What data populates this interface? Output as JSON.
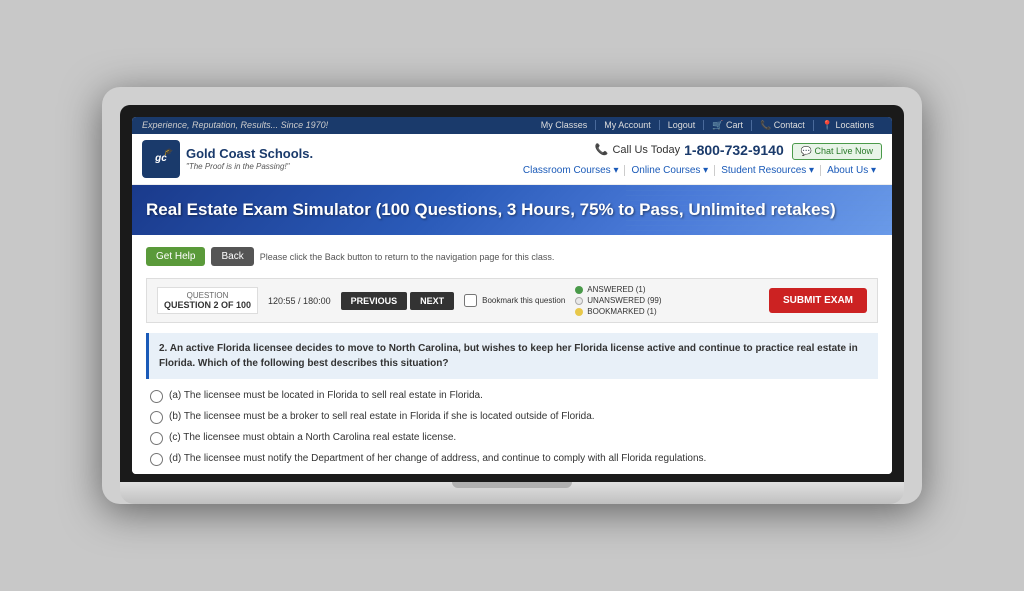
{
  "topbar": {
    "tagline": "Experience, Reputation, Results... Since 1970!",
    "links": [
      "My Classes",
      "My Account",
      "Logout",
      "🛒 Cart",
      "📞 Contact",
      "📍 Locations"
    ]
  },
  "logo": {
    "initials": "gc",
    "name": "Gold Coast Schools.",
    "tagline": "\"The Proof is in the Passing!\""
  },
  "phone": {
    "label": "Call Us Today",
    "number": "1-800-732-9140",
    "chat": "💬 Chat Live Now"
  },
  "subnav": {
    "links": [
      "Classroom Courses ▾",
      "Online Courses ▾",
      "Student Resources ▾",
      "About Us ▾"
    ]
  },
  "hero": {
    "title": "Real Estate Exam Simulator (100 Questions, 3 Hours, 75% to Pass, Unlimited retakes)"
  },
  "actions": {
    "get_help": "Get Help",
    "back": "Back",
    "help_text": "Please click the Back button to return to the navigation page for this class."
  },
  "quiz": {
    "question_label": "QUESTION 2 OF 100",
    "timer": "120:55 / 180:00",
    "prev_label": "PREVIOUS",
    "next_label": "NEXT",
    "bookmark_label": "Bookmark this question",
    "stats": [
      {
        "label": "ANSWERED (1)",
        "type": "answered"
      },
      {
        "label": "UNANSWERED (99)",
        "type": "unanswered"
      },
      {
        "label": "BOOKMARKED (1)",
        "type": "bookmarked"
      }
    ],
    "submit_label": "SUBMIT EXAM"
  },
  "question": {
    "text": "2. An active Florida licensee decides to move to North Carolina, but wishes to keep her Florida license active and continue to practice real estate in Florida. Which of the following best describes this situation?",
    "answers": [
      {
        "id": "a",
        "text": "(a) The licensee must be located in Florida to sell real estate in Florida."
      },
      {
        "id": "b",
        "text": "(b) The licensee must be a broker to sell real estate in Florida if she is located outside of Florida."
      },
      {
        "id": "c",
        "text": "(c) The licensee must obtain a North Carolina real estate license."
      },
      {
        "id": "d",
        "text": "(d) The licensee must notify the Department of her change of address, and continue to comply with all Florida regulations."
      }
    ]
  }
}
